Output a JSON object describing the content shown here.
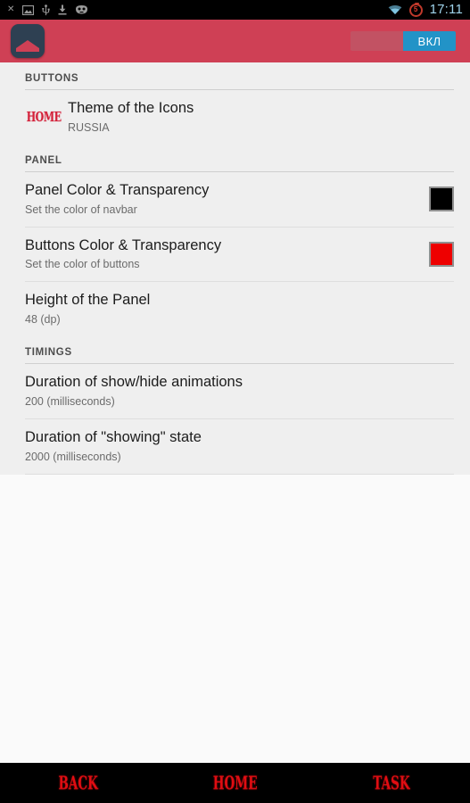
{
  "statusbar": {
    "icons_left": [
      "close-x-icon",
      "gallery-icon",
      "usb-icon",
      "download-icon",
      "cyanogenmod-head-icon"
    ],
    "wifi_icon": "wifi-icon",
    "battery_badge_value": "5",
    "clock": "17:11",
    "clock_color": "#9fd3ea"
  },
  "appbar": {
    "app_icon": "app-logo-icon",
    "accent_color": "#cf4055",
    "toggle": {
      "on_label": "ВКЛ",
      "on_color": "#2293c7",
      "off_color": "#c25263",
      "state": "on"
    }
  },
  "sections": [
    {
      "header": "BUTTONS",
      "rows": [
        {
          "icon": "home-theme-icon",
          "icon_text": "HOME",
          "title": "Theme of the Icons",
          "subtitle": "RUSSIA",
          "swatch": null
        }
      ]
    },
    {
      "header": "PANEL",
      "rows": [
        {
          "icon": null,
          "icon_text": null,
          "title": "Panel Color & Transparency",
          "subtitle": "Set the color of navbar",
          "swatch": "#000000"
        },
        {
          "icon": null,
          "icon_text": null,
          "title": "Buttons Color & Transparency",
          "subtitle": "Set the color of buttons",
          "swatch": "#ee0000"
        },
        {
          "icon": null,
          "icon_text": null,
          "title": "Height of the Panel",
          "subtitle": "48 (dp)",
          "swatch": null
        }
      ]
    },
    {
      "header": "TIMINGS",
      "rows": [
        {
          "icon": null,
          "icon_text": null,
          "title": "Duration of show/hide animations",
          "subtitle": "200 (milliseconds)",
          "swatch": null
        },
        {
          "icon": null,
          "icon_text": null,
          "title": "Duration of \"showing\" state",
          "subtitle": "2000 (milliseconds)",
          "swatch": null
        }
      ]
    }
  ],
  "navbar": {
    "background": "#000000",
    "label_color": "#e10d12",
    "buttons": [
      {
        "name": "back",
        "label": "BACK"
      },
      {
        "name": "home",
        "label": "HOME"
      },
      {
        "name": "task",
        "label": "TASK"
      }
    ]
  }
}
